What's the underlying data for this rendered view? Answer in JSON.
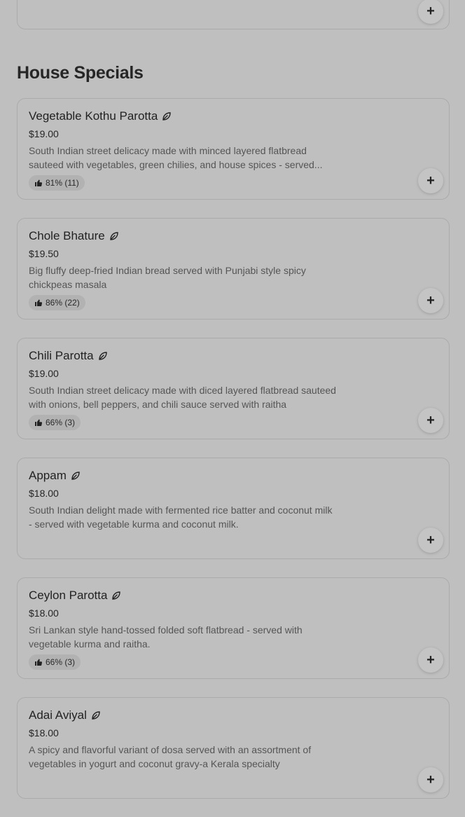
{
  "top_card": {
    "add_label": "+"
  },
  "section": {
    "title": "House Specials"
  },
  "items": [
    {
      "name": "Vegetable Kothu Parotta",
      "price": "$19.00",
      "description": "South Indian street delicacy made with minced layered flatbread sauteed with vegetables, green chilies, and house spices - served...",
      "rating": "81% (11)",
      "icon": "leaf-icon",
      "add_label": "+"
    },
    {
      "name": "Chole Bhature",
      "price": "$19.50",
      "description": "Big fluffy deep-fried Indian bread served with Punjabi style spicy chickpeas masala",
      "rating": "86% (22)",
      "icon": "leaf-icon",
      "add_label": "+"
    },
    {
      "name": "Chili Parotta",
      "price": "$19.00",
      "description": "South Indian street delicacy made with diced layered flatbread sauteed with onions, bell peppers, and chili sauce served with raitha",
      "rating": "66% (3)",
      "icon": "leaf-icon",
      "add_label": "+"
    },
    {
      "name": "Appam",
      "price": "$18.00",
      "description": "South Indian delight made with fermented rice batter and coconut milk - served with vegetable kurma and coconut milk.",
      "rating": null,
      "icon": "leaf-icon",
      "add_label": "+"
    },
    {
      "name": "Ceylon Parotta",
      "price": "$18.00",
      "description": "Sri Lankan style hand-tossed folded soft flatbread - served with vegetable kurma and raitha.",
      "rating": "66% (3)",
      "icon": "leaf-icon",
      "add_label": "+"
    },
    {
      "name": "Adai Aviyal",
      "price": "$18.00",
      "description": "A spicy and flavorful variant of dosa served with an assortment of vegetables in yogurt and coconut gravy-a Kerala specialty",
      "rating": null,
      "icon": "leaf-icon",
      "add_label": "+"
    }
  ]
}
